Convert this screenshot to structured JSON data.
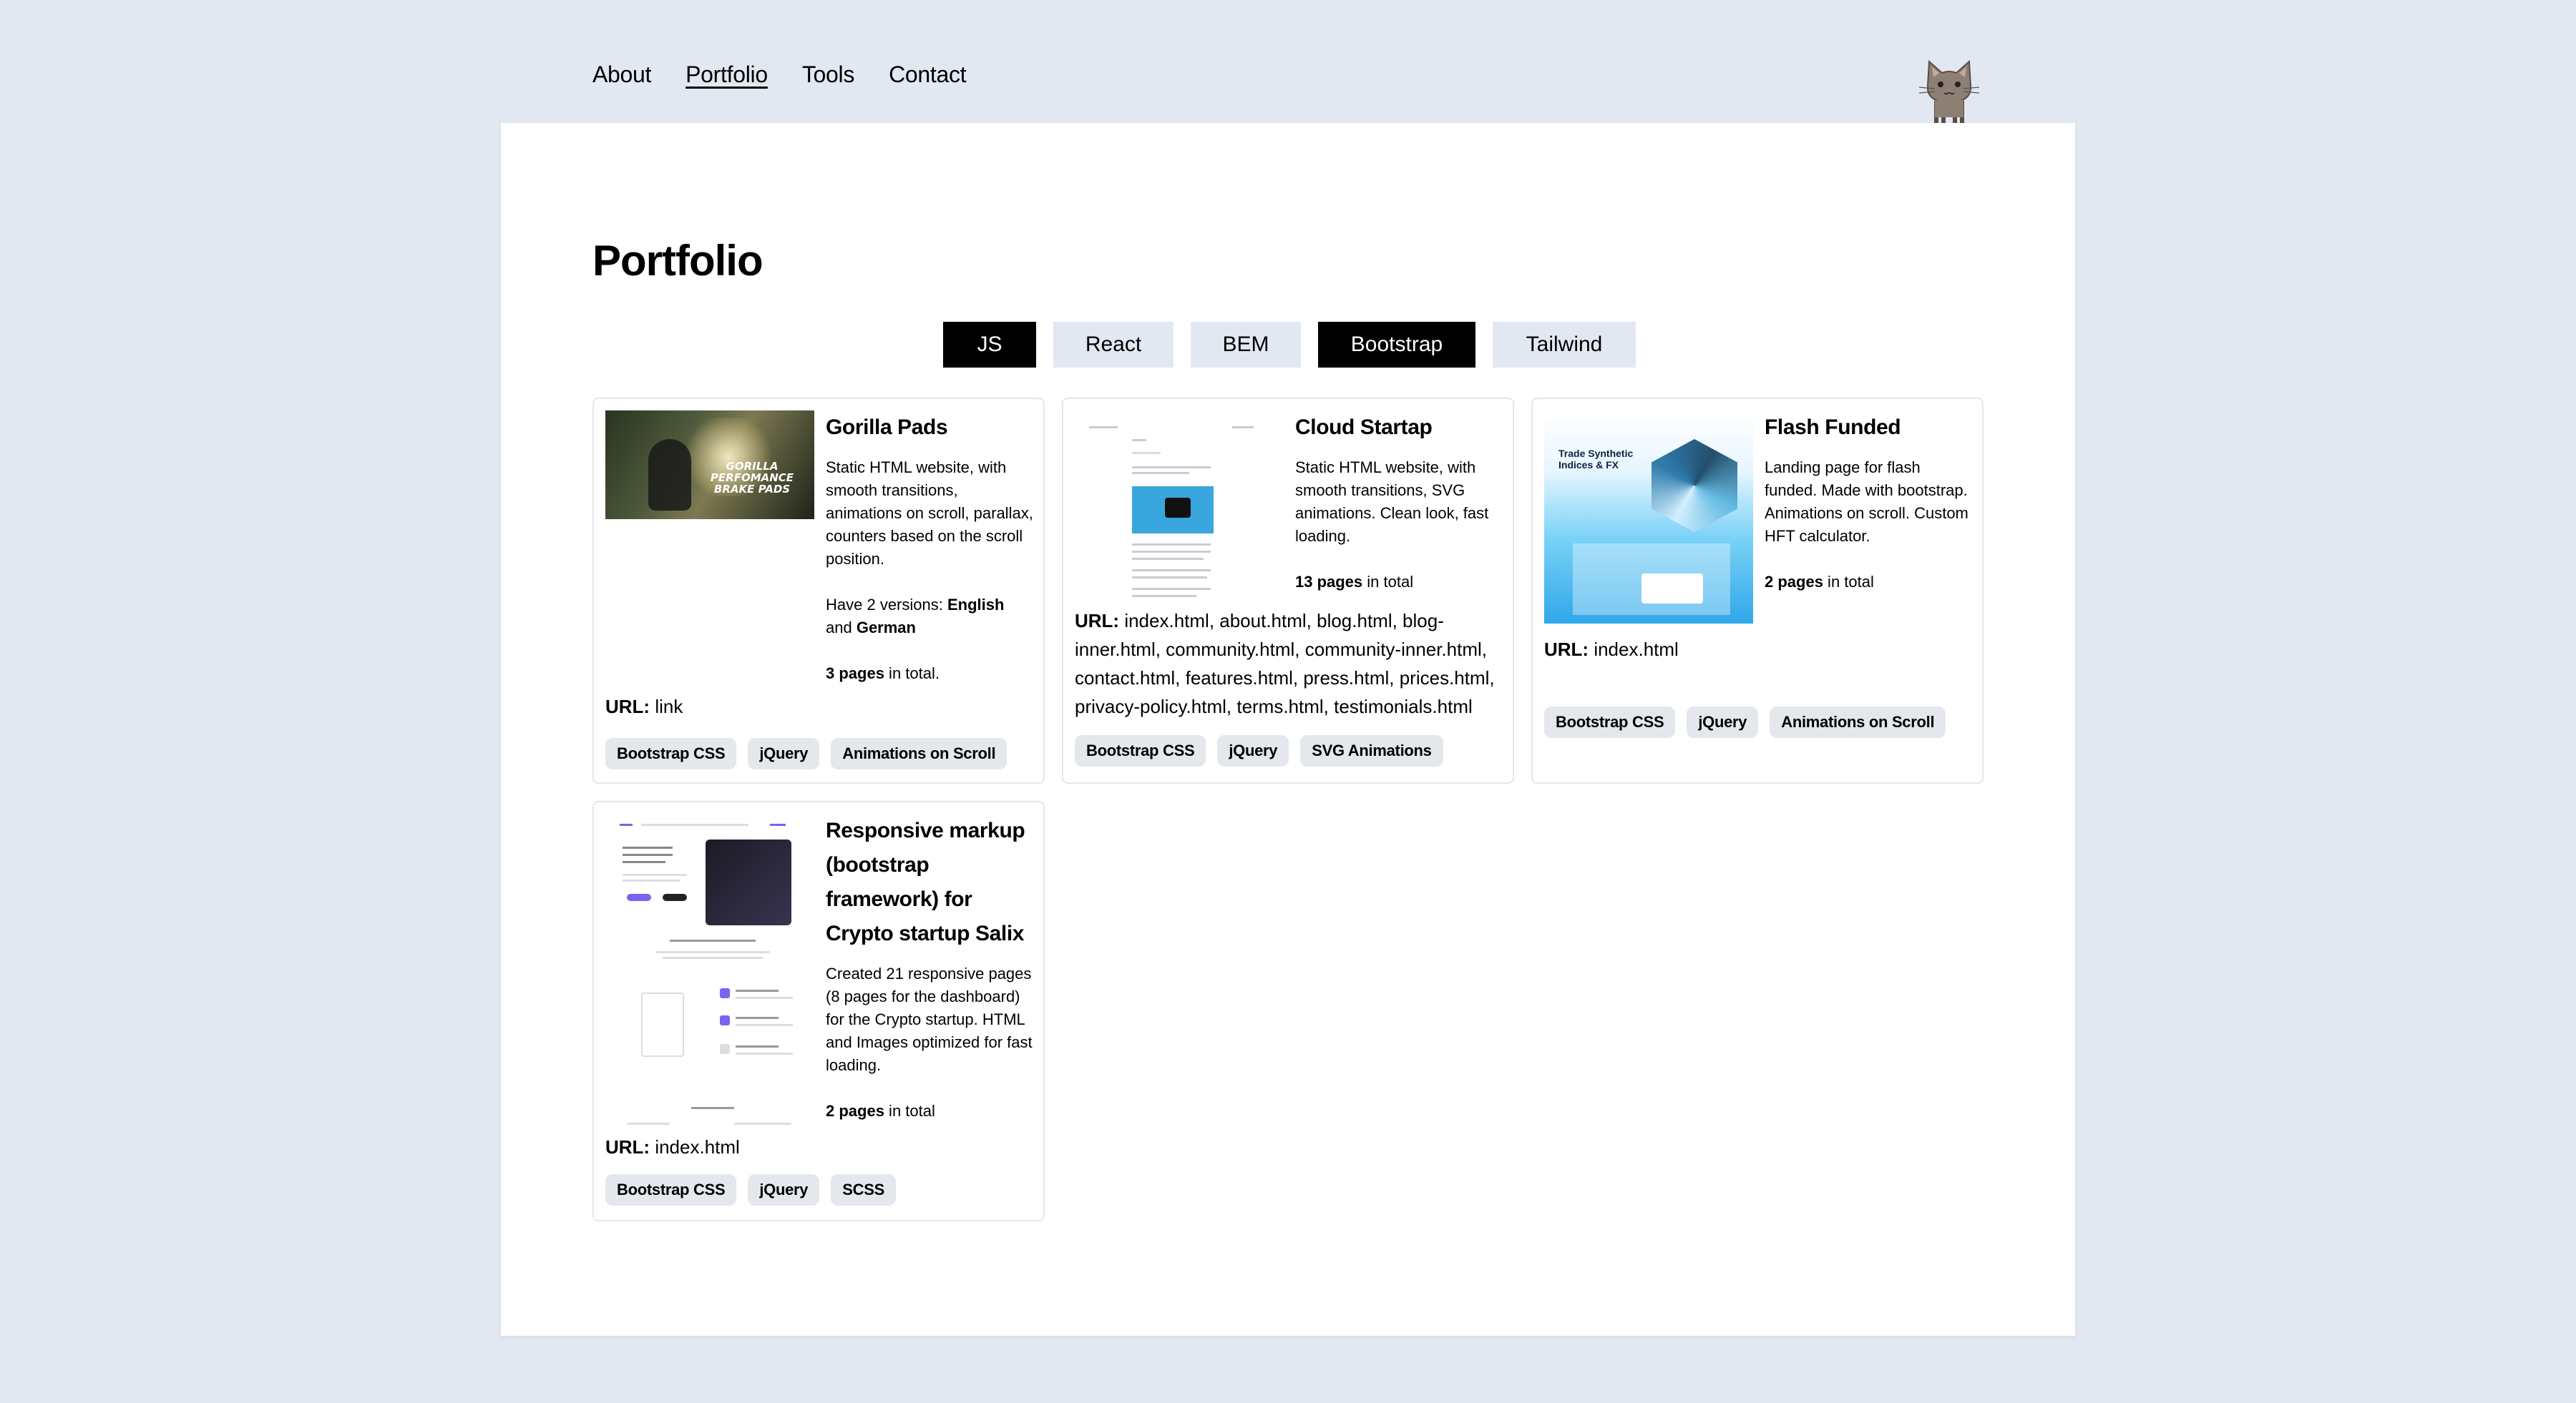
{
  "nav": {
    "items": [
      "About",
      "Portfolio",
      "Tools",
      "Contact"
    ],
    "active": "Portfolio"
  },
  "page": {
    "title": "Portfolio"
  },
  "filters": [
    {
      "label": "JS",
      "active": true
    },
    {
      "label": "React",
      "active": false
    },
    {
      "label": "BEM",
      "active": false
    },
    {
      "label": "Bootstrap",
      "active": true
    },
    {
      "label": "Tailwind",
      "active": false
    }
  ],
  "colors": {
    "background": "#e1e8f1",
    "active_filter": "#000000",
    "inactive_filter": "#e1e8f1",
    "tag": "#e4e7ec"
  },
  "cards": [
    {
      "title": "Gorilla Pads",
      "desc": "Static HTML website, with smooth transitions, animations on scroll, parallax, counters based on the scroll position.",
      "extra_prefix": "Have 2 versions: ",
      "extra_bold_1": "English",
      "extra_mid": " and ",
      "extra_bold_2": "German",
      "pages_bold": "3 pages",
      "pages_rest": " in total.",
      "url_label": "URL:",
      "url_value": " link",
      "tags": [
        "Bootstrap CSS",
        "jQuery",
        "Animations on Scroll"
      ],
      "thumb_text": "GORILLA PERFOMANCE BRAKE PADS"
    },
    {
      "title": "Cloud Startap",
      "desc": "Static HTML website, with smooth transitions, SVG animations. Clean look, fast loading.",
      "pages_bold": "13 pages",
      "pages_rest": " in total",
      "url_label": "URL:",
      "url_value": " index.html, about.html, blog.html, blog-inner.html, community.html, community-inner.html, contact.html, features.html, press.html, prices.html, privacy-policy.html, terms.html, testimonials.html",
      "tags": [
        "Bootstrap CSS",
        "jQuery",
        "SVG Animations"
      ]
    },
    {
      "title": "Flash Funded",
      "desc": "Landing page for flash funded. Made with bootstrap. Animations on scroll. Custom HFT calculator.",
      "pages_bold": "2 pages",
      "pages_rest": " in total",
      "url_label": "URL:",
      "url_value": " index.html",
      "tags": [
        "Bootstrap CSS",
        "jQuery",
        "Animations on Scroll"
      ],
      "thumb_text": "Trade Synthetic Indices & FX"
    },
    {
      "title": "Responsive markup (bootstrap framework) for Crypto startup Salix",
      "desc": "Created 21 responsive pages (8 pages for the dashboard) for the Crypto startup. HTML and Images optimized for fast loading.",
      "pages_bold": "2 pages",
      "pages_rest": " in total",
      "url_label": "URL:",
      "url_value": " index.html",
      "tags": [
        "Bootstrap CSS",
        "jQuery",
        "SCSS"
      ]
    }
  ]
}
